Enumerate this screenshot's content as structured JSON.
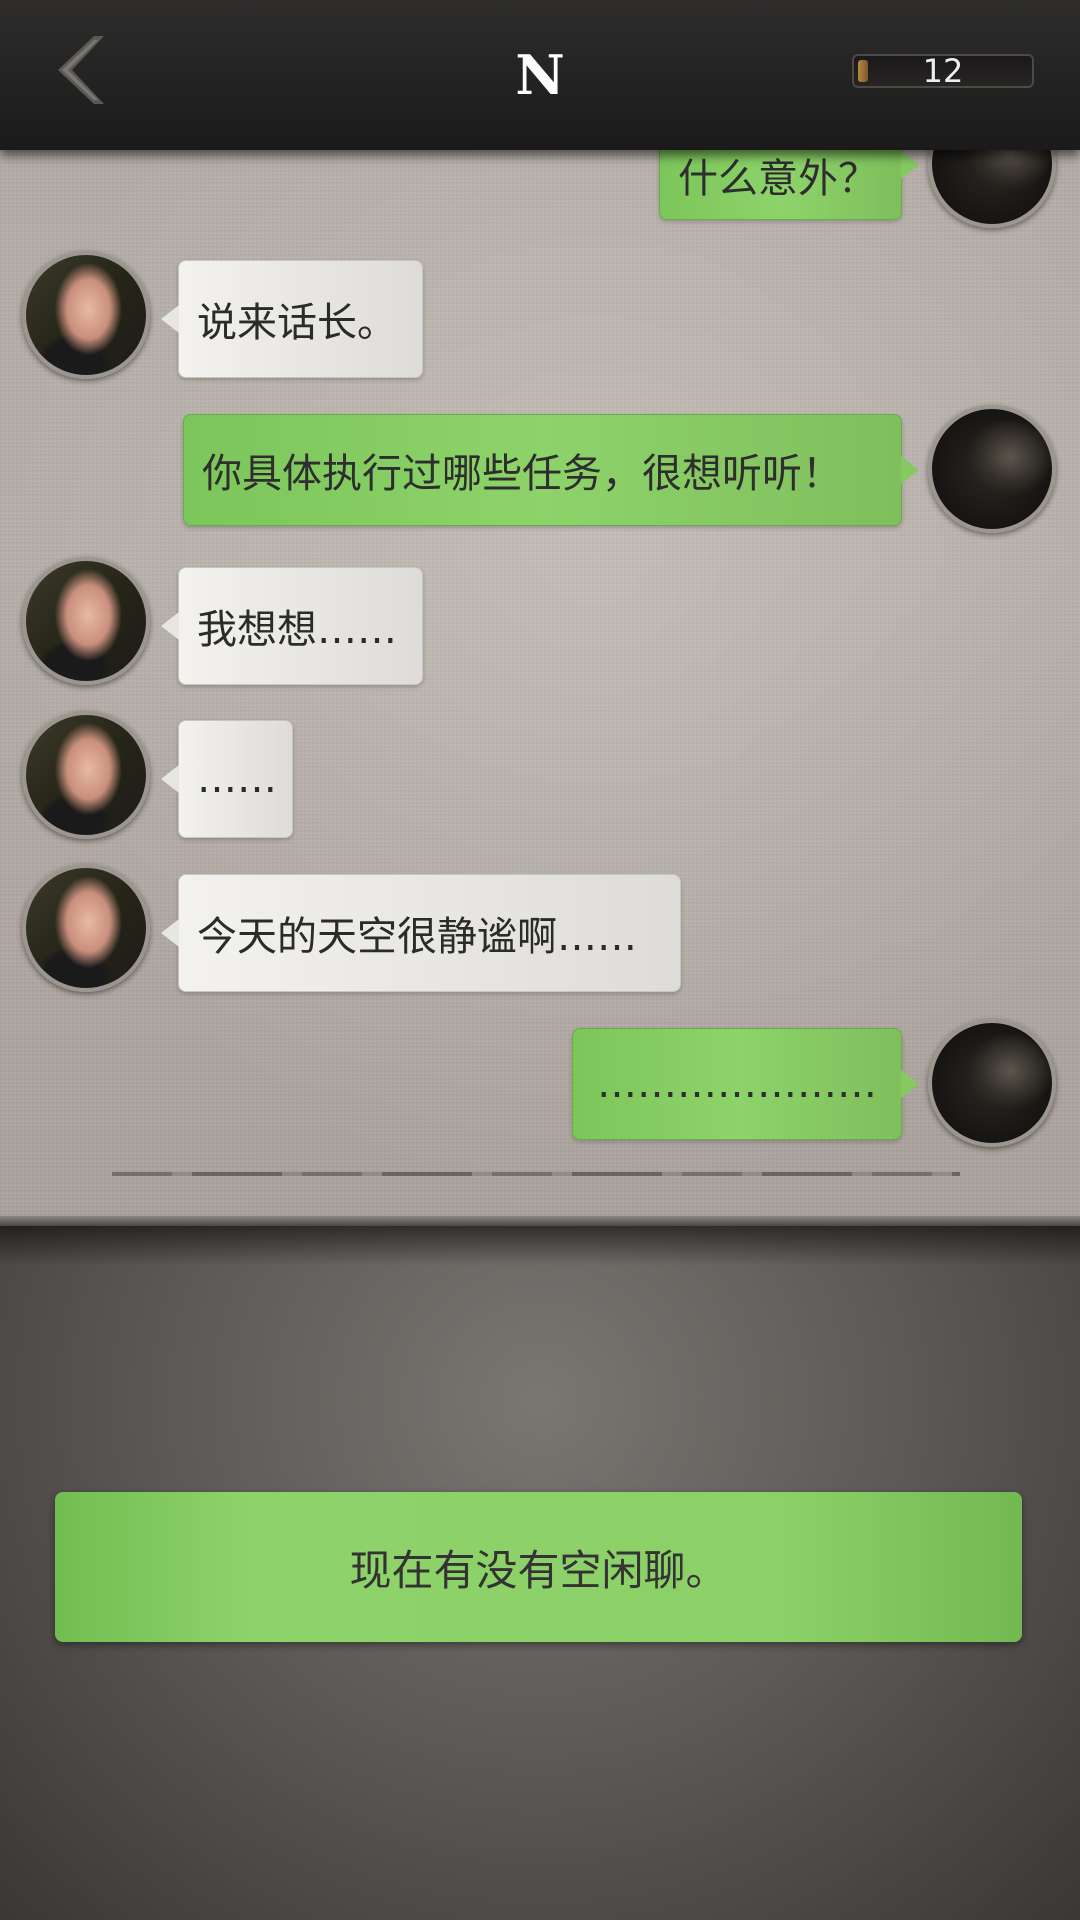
{
  "header": {
    "title": "N",
    "counter_value": "12",
    "counter_fill": 0.06
  },
  "messages": [
    {
      "side": "right",
      "text": "什么意外？"
    },
    {
      "side": "left",
      "text": "说来话长。"
    },
    {
      "side": "right",
      "text": "你具体执行过哪些任务，很想听听！"
    },
    {
      "side": "left",
      "text": "我想想……"
    },
    {
      "side": "left",
      "text": "……"
    },
    {
      "side": "left",
      "text": "今天的天空很静谧啊……"
    },
    {
      "side": "right",
      "text": "…………………"
    }
  ],
  "reply": {
    "label": "现在有没有空闲聊。"
  },
  "colors": {
    "header_bg": "#1f1e1d",
    "bubble_green": "#8cd068",
    "bubble_white": "#ececea",
    "paper": "#b3aba5"
  },
  "icons": {
    "back": "chevron-left-icon"
  }
}
